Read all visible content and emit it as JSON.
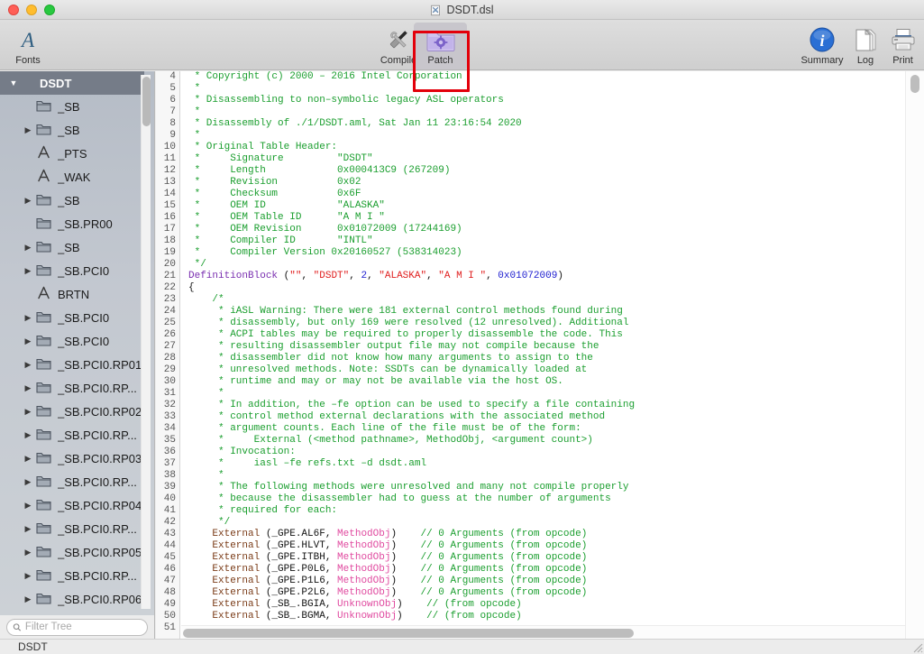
{
  "window": {
    "title": "DSDT.dsl",
    "doc_icon": "document-icon",
    "traffic": {
      "close": "close-window-button",
      "minimize": "minimize-window-button",
      "zoom": "zoom-window-button"
    }
  },
  "toolbar": {
    "fonts_label": "Fonts",
    "compile_label": "Compile",
    "patch_label": "Patch",
    "summary_label": "Summary",
    "log_label": "Log",
    "print_label": "Print",
    "highlight_color": "#e3000b",
    "patch_pressed": true
  },
  "sidebar": {
    "header": {
      "label": "DSDT",
      "twisty": "▼"
    },
    "items": [
      {
        "twisty": "",
        "icon": "folder-icon",
        "label": "_SB"
      },
      {
        "twisty": "▶",
        "icon": "folder-icon",
        "label": "_SB"
      },
      {
        "twisty": "",
        "icon": "method-icon",
        "label": "_PTS"
      },
      {
        "twisty": "",
        "icon": "method-icon",
        "label": "_WAK"
      },
      {
        "twisty": "▶",
        "icon": "folder-icon",
        "label": "_SB"
      },
      {
        "twisty": "",
        "icon": "folder-icon",
        "label": "_SB.PR00"
      },
      {
        "twisty": "▶",
        "icon": "folder-icon",
        "label": "_SB"
      },
      {
        "twisty": "▶",
        "icon": "folder-icon",
        "label": "_SB.PCI0"
      },
      {
        "twisty": "",
        "icon": "method-icon",
        "label": "BRTN"
      },
      {
        "twisty": "▶",
        "icon": "folder-icon",
        "label": "_SB.PCI0"
      },
      {
        "twisty": "▶",
        "icon": "folder-icon",
        "label": "_SB.PCI0"
      },
      {
        "twisty": "▶",
        "icon": "folder-icon",
        "label": "_SB.PCI0.RP01"
      },
      {
        "twisty": "▶",
        "icon": "folder-icon",
        "label": "_SB.PCI0.RP..."
      },
      {
        "twisty": "▶",
        "icon": "folder-icon",
        "label": "_SB.PCI0.RP02"
      },
      {
        "twisty": "▶",
        "icon": "folder-icon",
        "label": "_SB.PCI0.RP..."
      },
      {
        "twisty": "▶",
        "icon": "folder-icon",
        "label": "_SB.PCI0.RP03"
      },
      {
        "twisty": "▶",
        "icon": "folder-icon",
        "label": "_SB.PCI0.RP..."
      },
      {
        "twisty": "▶",
        "icon": "folder-icon",
        "label": "_SB.PCI0.RP04"
      },
      {
        "twisty": "▶",
        "icon": "folder-icon",
        "label": "_SB.PCI0.RP..."
      },
      {
        "twisty": "▶",
        "icon": "folder-icon",
        "label": "_SB.PCI0.RP05"
      },
      {
        "twisty": "▶",
        "icon": "folder-icon",
        "label": "_SB.PCI0.RP..."
      },
      {
        "twisty": "▶",
        "icon": "folder-icon",
        "label": "_SB.PCI0.RP06"
      }
    ]
  },
  "filter": {
    "placeholder": "Filter Tree",
    "value": "",
    "icon": "search-icon"
  },
  "statusbar": {
    "text": "DSDT"
  },
  "editor": {
    "first_line": 4,
    "last_line": 51,
    "lines": [
      {
        "n": 4,
        "spans": [
          {
            "t": " * Copyright (c) 2000 – 2016 Intel Corporation",
            "c": "c-com"
          }
        ]
      },
      {
        "n": 5,
        "spans": [
          {
            "t": " *",
            "c": "c-com"
          }
        ]
      },
      {
        "n": 6,
        "spans": [
          {
            "t": " * Disassembling to non–symbolic legacy ASL operators",
            "c": "c-com"
          }
        ]
      },
      {
        "n": 7,
        "spans": [
          {
            "t": " *",
            "c": "c-com"
          }
        ]
      },
      {
        "n": 8,
        "spans": [
          {
            "t": " * Disassembly of ./1/DSDT.aml, Sat Jan 11 23:16:54 2020",
            "c": "c-com"
          }
        ]
      },
      {
        "n": 9,
        "spans": [
          {
            "t": " *",
            "c": "c-com"
          }
        ]
      },
      {
        "n": 10,
        "spans": [
          {
            "t": " * Original Table Header:",
            "c": "c-com"
          }
        ]
      },
      {
        "n": 11,
        "spans": [
          {
            "t": " *     Signature         \"DSDT\"",
            "c": "c-com"
          }
        ]
      },
      {
        "n": 12,
        "spans": [
          {
            "t": " *     Length            0x000413C9 (267209)",
            "c": "c-com"
          }
        ]
      },
      {
        "n": 13,
        "spans": [
          {
            "t": " *     Revision          0x02",
            "c": "c-com"
          }
        ]
      },
      {
        "n": 14,
        "spans": [
          {
            "t": " *     Checksum          0x6F",
            "c": "c-com"
          }
        ]
      },
      {
        "n": 15,
        "spans": [
          {
            "t": " *     OEM ID            \"ALASKA\"",
            "c": "c-com"
          }
        ]
      },
      {
        "n": 16,
        "spans": [
          {
            "t": " *     OEM Table ID      \"A M I \"",
            "c": "c-com"
          }
        ]
      },
      {
        "n": 17,
        "spans": [
          {
            "t": " *     OEM Revision      0x01072009 (17244169)",
            "c": "c-com"
          }
        ]
      },
      {
        "n": 18,
        "spans": [
          {
            "t": " *     Compiler ID       \"INTL\"",
            "c": "c-com"
          }
        ]
      },
      {
        "n": 19,
        "spans": [
          {
            "t": " *     Compiler Version 0x20160527 (538314023)",
            "c": "c-com"
          }
        ]
      },
      {
        "n": 20,
        "spans": [
          {
            "t": " */",
            "c": "c-com"
          }
        ]
      },
      {
        "n": 21,
        "spans": [
          {
            "t": "DefinitionBlock",
            "c": "c-fn"
          },
          {
            "t": " (",
            "c": "c-pl"
          },
          {
            "t": "\"\"",
            "c": "c-str"
          },
          {
            "t": ", ",
            "c": "c-pl"
          },
          {
            "t": "\"DSDT\"",
            "c": "c-str"
          },
          {
            "t": ", ",
            "c": "c-pl"
          },
          {
            "t": "2",
            "c": "c-num"
          },
          {
            "t": ", ",
            "c": "c-pl"
          },
          {
            "t": "\"ALASKA\"",
            "c": "c-str"
          },
          {
            "t": ", ",
            "c": "c-pl"
          },
          {
            "t": "\"A M I \"",
            "c": "c-str"
          },
          {
            "t": ", ",
            "c": "c-pl"
          },
          {
            "t": "0x01072009",
            "c": "c-num"
          },
          {
            "t": ")",
            "c": "c-pl"
          }
        ]
      },
      {
        "n": 22,
        "spans": [
          {
            "t": "{",
            "c": "c-pl"
          }
        ]
      },
      {
        "n": 23,
        "spans": [
          {
            "t": "    /*",
            "c": "c-com"
          }
        ]
      },
      {
        "n": 24,
        "spans": [
          {
            "t": "     * iASL Warning: There were 181 external control methods found during",
            "c": "c-com"
          }
        ]
      },
      {
        "n": 25,
        "spans": [
          {
            "t": "     * disassembly, but only 169 were resolved (12 unresolved). Additional",
            "c": "c-com"
          }
        ]
      },
      {
        "n": 26,
        "spans": [
          {
            "t": "     * ACPI tables may be required to properly disassemble the code. This",
            "c": "c-com"
          }
        ]
      },
      {
        "n": 27,
        "spans": [
          {
            "t": "     * resulting disassembler output file may not compile because the",
            "c": "c-com"
          }
        ]
      },
      {
        "n": 28,
        "spans": [
          {
            "t": "     * disassembler did not know how many arguments to assign to the",
            "c": "c-com"
          }
        ]
      },
      {
        "n": 29,
        "spans": [
          {
            "t": "     * unresolved methods. Note: SSDTs can be dynamically loaded at",
            "c": "c-com"
          }
        ]
      },
      {
        "n": 30,
        "spans": [
          {
            "t": "     * runtime and may or may not be available via the host OS.",
            "c": "c-com"
          }
        ]
      },
      {
        "n": 31,
        "spans": [
          {
            "t": "     *",
            "c": "c-com"
          }
        ]
      },
      {
        "n": 32,
        "spans": [
          {
            "t": "     * In addition, the –fe option can be used to specify a file containing",
            "c": "c-com"
          }
        ]
      },
      {
        "n": 33,
        "spans": [
          {
            "t": "     * control method external declarations with the associated method",
            "c": "c-com"
          }
        ]
      },
      {
        "n": 34,
        "spans": [
          {
            "t": "     * argument counts. Each line of the file must be of the form:",
            "c": "c-com"
          }
        ]
      },
      {
        "n": 35,
        "spans": [
          {
            "t": "     *     External (<method pathname>, MethodObj, <argument count>)",
            "c": "c-com"
          }
        ]
      },
      {
        "n": 36,
        "spans": [
          {
            "t": "     * Invocation:",
            "c": "c-com"
          }
        ]
      },
      {
        "n": 37,
        "spans": [
          {
            "t": "     *     iasl –fe refs.txt –d dsdt.aml",
            "c": "c-com"
          }
        ]
      },
      {
        "n": 38,
        "spans": [
          {
            "t": "     *",
            "c": "c-com"
          }
        ]
      },
      {
        "n": 39,
        "spans": [
          {
            "t": "     * The following methods were unresolved and many not compile properly",
            "c": "c-com"
          }
        ]
      },
      {
        "n": 40,
        "spans": [
          {
            "t": "     * because the disassembler had to guess at the number of arguments",
            "c": "c-com"
          }
        ]
      },
      {
        "n": 41,
        "spans": [
          {
            "t": "     * required for each:",
            "c": "c-com"
          }
        ]
      },
      {
        "n": 42,
        "spans": [
          {
            "t": "     */",
            "c": "c-com"
          }
        ]
      },
      {
        "n": 43,
        "spans": [
          {
            "t": "    External",
            "c": "c-kw"
          },
          {
            "t": " (_GPE.AL6F, ",
            "c": "c-pl"
          },
          {
            "t": "MethodObj",
            "c": "c-type"
          },
          {
            "t": ")    ",
            "c": "c-pl"
          },
          {
            "t": "// 0 Arguments (from opcode)",
            "c": "c-com"
          }
        ]
      },
      {
        "n": 44,
        "spans": [
          {
            "t": "    External",
            "c": "c-kw"
          },
          {
            "t": " (_GPE.HLVT, ",
            "c": "c-pl"
          },
          {
            "t": "MethodObj",
            "c": "c-type"
          },
          {
            "t": ")    ",
            "c": "c-pl"
          },
          {
            "t": "// 0 Arguments (from opcode)",
            "c": "c-com"
          }
        ]
      },
      {
        "n": 45,
        "spans": [
          {
            "t": "    External",
            "c": "c-kw"
          },
          {
            "t": " (_GPE.ITBH, ",
            "c": "c-pl"
          },
          {
            "t": "MethodObj",
            "c": "c-type"
          },
          {
            "t": ")    ",
            "c": "c-pl"
          },
          {
            "t": "// 0 Arguments (from opcode)",
            "c": "c-com"
          }
        ]
      },
      {
        "n": 46,
        "spans": [
          {
            "t": "    External",
            "c": "c-kw"
          },
          {
            "t": " (_GPE.P0L6, ",
            "c": "c-pl"
          },
          {
            "t": "MethodObj",
            "c": "c-type"
          },
          {
            "t": ")    ",
            "c": "c-pl"
          },
          {
            "t": "// 0 Arguments (from opcode)",
            "c": "c-com"
          }
        ]
      },
      {
        "n": 47,
        "spans": [
          {
            "t": "    External",
            "c": "c-kw"
          },
          {
            "t": " (_GPE.P1L6, ",
            "c": "c-pl"
          },
          {
            "t": "MethodObj",
            "c": "c-type"
          },
          {
            "t": ")    ",
            "c": "c-pl"
          },
          {
            "t": "// 0 Arguments (from opcode)",
            "c": "c-com"
          }
        ]
      },
      {
        "n": 48,
        "spans": [
          {
            "t": "    External",
            "c": "c-kw"
          },
          {
            "t": " (_GPE.P2L6, ",
            "c": "c-pl"
          },
          {
            "t": "MethodObj",
            "c": "c-type"
          },
          {
            "t": ")    ",
            "c": "c-pl"
          },
          {
            "t": "// 0 Arguments (from opcode)",
            "c": "c-com"
          }
        ]
      },
      {
        "n": 49,
        "spans": [
          {
            "t": "    External",
            "c": "c-kw"
          },
          {
            "t": " (_SB_.BGIA, ",
            "c": "c-pl"
          },
          {
            "t": "UnknownObj",
            "c": "c-type"
          },
          {
            "t": ")    ",
            "c": "c-pl"
          },
          {
            "t": "// (from opcode)",
            "c": "c-com"
          }
        ]
      },
      {
        "n": 50,
        "spans": [
          {
            "t": "    External",
            "c": "c-kw"
          },
          {
            "t": " (_SB_.BGMA, ",
            "c": "c-pl"
          },
          {
            "t": "UnknownObj",
            "c": "c-type"
          },
          {
            "t": ")    ",
            "c": "c-pl"
          },
          {
            "t": "// (from opcode)",
            "c": "c-com"
          }
        ]
      },
      {
        "n": 51,
        "spans": [
          {
            "t": "",
            "c": "c-pl"
          }
        ]
      }
    ]
  },
  "colors": {
    "comment": "#1a9e2e",
    "keyword": "#7a3b17",
    "type": "#e0499f",
    "string": "#e02020",
    "number": "#2020d0",
    "function": "#7a2fb0",
    "sidebar_header": "#757c88",
    "highlight": "#e3000b"
  }
}
